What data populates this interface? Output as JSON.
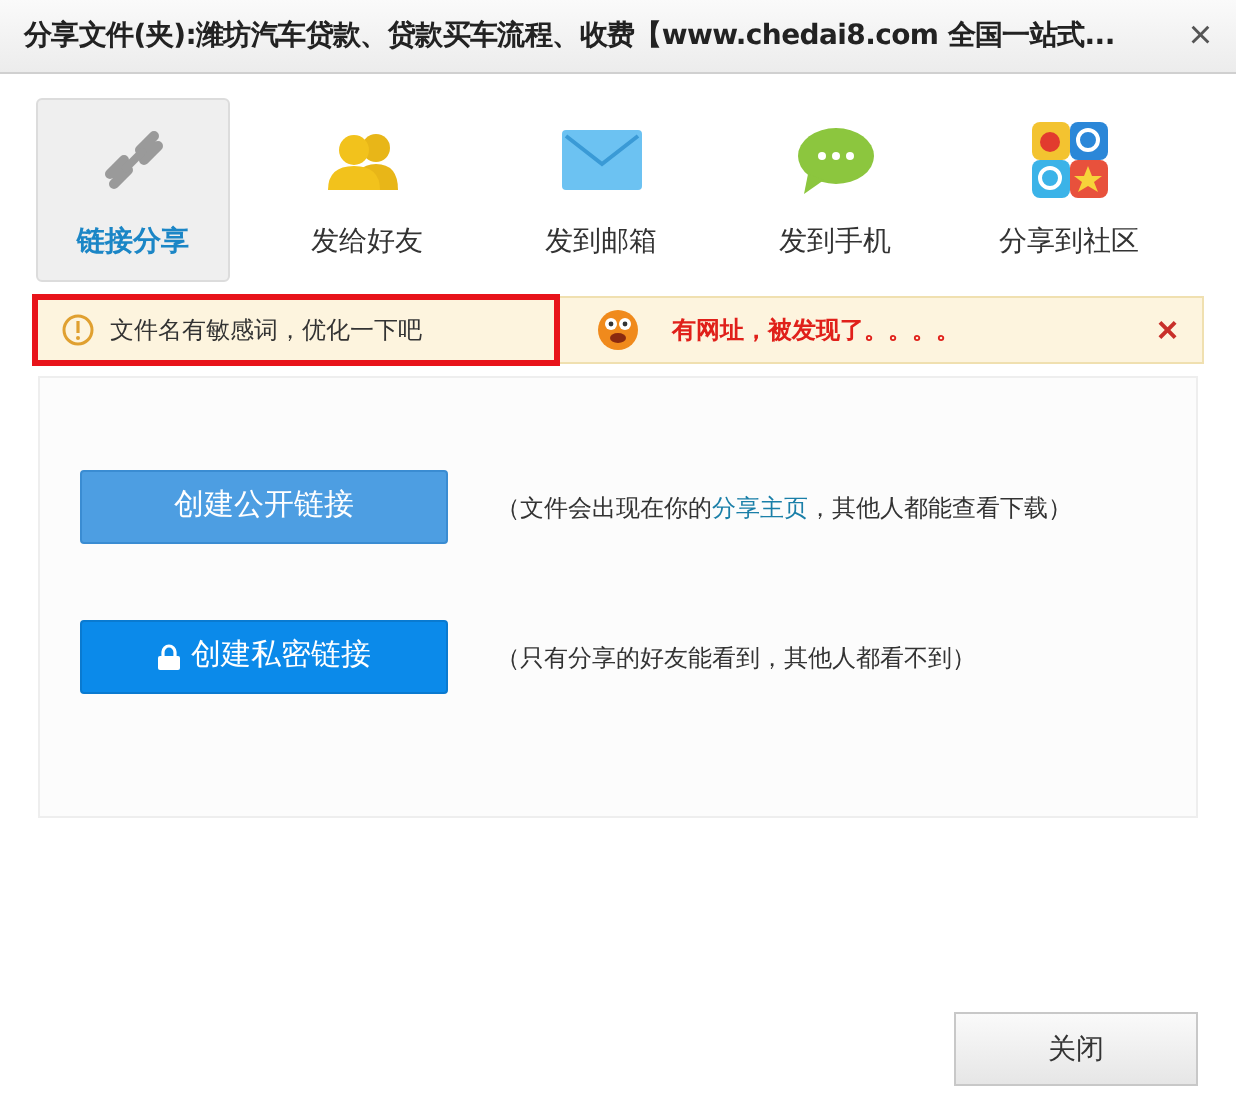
{
  "window": {
    "title": "分享文件(夹):潍坊汽车贷款、贷款买车流程、收费【www.chedai8.com 全国一站式...",
    "close": "×"
  },
  "tabs": [
    {
      "label": "链接分享",
      "kind": "link",
      "selected": true
    },
    {
      "label": "发给好友",
      "kind": "friends",
      "selected": false
    },
    {
      "label": "发到邮箱",
      "kind": "mail",
      "selected": false
    },
    {
      "label": "发到手机",
      "kind": "phone",
      "selected": false
    },
    {
      "label": "分享到社区",
      "kind": "community",
      "selected": false
    }
  ],
  "notice": {
    "warning": "文件名有敏感词，优化一下吧",
    "highlighted": true,
    "message": "有网址，被发现了。。。。",
    "dismiss": "×"
  },
  "options": [
    {
      "kind": "public",
      "button": "创建公开链接",
      "text_before": "（文件会出现在你的",
      "link": "分享主页",
      "text_after": "，其他人都能查看下载）"
    },
    {
      "kind": "private",
      "button": "创建私密链接",
      "text_before": "（只有分享的好友能看到，其他人都看不到）"
    }
  ],
  "footer": {
    "close": "关闭"
  }
}
